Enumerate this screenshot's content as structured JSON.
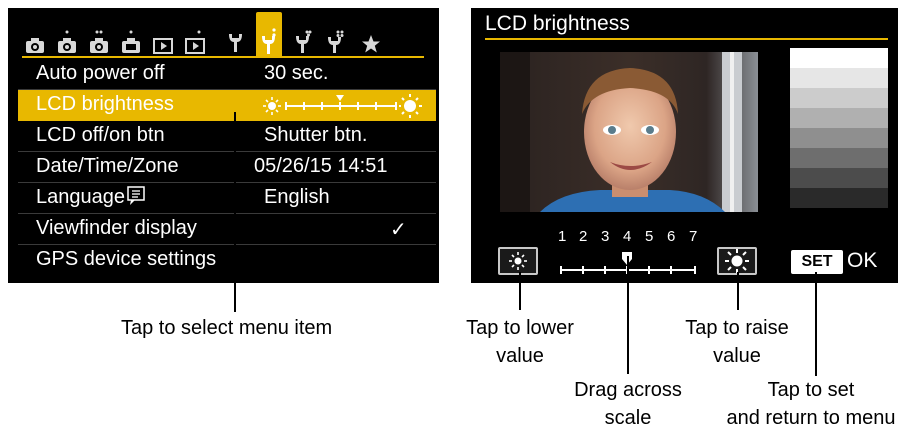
{
  "left_screen": {
    "tabs": [
      {
        "icon": "camera-shoot-icon"
      },
      {
        "icon": "camera-shoot-icon"
      },
      {
        "icon": "camera-shoot-icon"
      },
      {
        "icon": "camera-shoot-icon"
      },
      {
        "icon": "playback-icon"
      },
      {
        "icon": "playback-icon"
      },
      {
        "icon": "wrench-icon"
      },
      {
        "icon": "wrench-icon",
        "active": true
      },
      {
        "icon": "wrench-icon"
      },
      {
        "icon": "wrench-icon"
      },
      {
        "icon": "star-icon"
      }
    ],
    "menu": [
      {
        "label": "Auto power off",
        "value": "30 sec."
      },
      {
        "label": "LCD brightness",
        "value": "",
        "selected": true
      },
      {
        "label": "LCD off/on btn",
        "value": "Shutter btn."
      },
      {
        "label": "Date/Time/Zone",
        "value": "05/26/15 14:51"
      },
      {
        "label": "Language",
        "value": "English"
      },
      {
        "label": "Viewfinder display",
        "value": "✓"
      },
      {
        "label": "GPS device settings",
        "value": ""
      }
    ],
    "brightness_level": 4,
    "brightness_max": 7
  },
  "right_screen": {
    "title": "LCD brightness",
    "scale_numbers": [
      "1",
      "2",
      "3",
      "4",
      "5",
      "6",
      "7"
    ],
    "current_level": 4,
    "set_label": "SET",
    "ok_label": "OK",
    "gray_levels": [
      "#ffffff",
      "#e6e6e6",
      "#cccccc",
      "#b0b0b0",
      "#8f8f8f",
      "#6e6e6e",
      "#4c4c4c",
      "#2a2a2a"
    ]
  },
  "callouts": {
    "select_item": "Tap to select menu item",
    "lower_line1": "Tap to lower",
    "lower_line2": "value",
    "raise_line1": "Tap to raise",
    "raise_line2": "value",
    "drag_line1": "Drag across",
    "drag_line2": "scale",
    "set_line1": "Tap to set",
    "set_line2": "and return to menu"
  },
  "colors": {
    "accent": "#e8b800",
    "screen_bg": "#000000"
  }
}
